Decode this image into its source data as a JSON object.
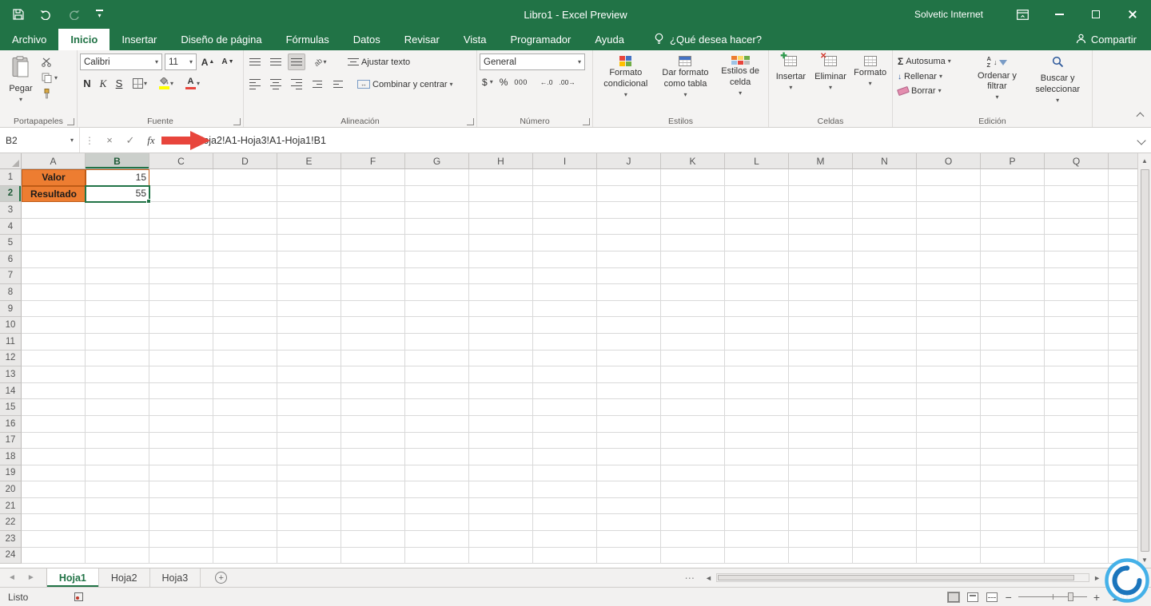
{
  "colors": {
    "excel_green": "#217346",
    "orange_fill": "#ED7D31",
    "orange_border": "#BF5B16",
    "arrow_red": "#E8453C"
  },
  "title_bar": {
    "title": "Libro1  -  Excel Preview",
    "account": "Solvetic Internet"
  },
  "tabs": {
    "items": [
      {
        "label": "Archivo",
        "active": false
      },
      {
        "label": "Inicio",
        "active": true
      },
      {
        "label": "Insertar",
        "active": false
      },
      {
        "label": "Diseño de página",
        "active": false
      },
      {
        "label": "Fórmulas",
        "active": false
      },
      {
        "label": "Datos",
        "active": false
      },
      {
        "label": "Revisar",
        "active": false
      },
      {
        "label": "Vista",
        "active": false
      },
      {
        "label": "Programador",
        "active": false
      },
      {
        "label": "Ayuda",
        "active": false
      }
    ],
    "search": "¿Qué desea hacer?",
    "share": "Compartir"
  },
  "ribbon": {
    "clipboard": {
      "paste": "Pegar",
      "group": "Portapapeles"
    },
    "font": {
      "family": "Calibri",
      "size": "11",
      "bold": "N",
      "italic": "K",
      "underline": "S",
      "group": "Fuente"
    },
    "alignment": {
      "wrap_text": "Ajustar texto",
      "merge_center": "Combinar y centrar",
      "group": "Alineación"
    },
    "number": {
      "format": "General",
      "currency": "$",
      "percent": "%",
      "thousands": "000",
      "group": "Número"
    },
    "styles": {
      "conditional": "Formato condicional",
      "format_table": "Dar formato como tabla",
      "cell_styles": "Estilos de celda",
      "group": "Estilos"
    },
    "cells": {
      "insert": "Insertar",
      "delete": "Eliminar",
      "format": "Formato",
      "group": "Celdas"
    },
    "editing": {
      "autosum": "Autosuma",
      "fill": "Rellenar",
      "clear": "Borrar",
      "sort_filter": "Ordenar y filtrar",
      "find_select": "Buscar y seleccionar",
      "group": "Edición"
    }
  },
  "formula_bar": {
    "name_box": "B2",
    "fx": "fx",
    "formula": "=Hoja2!A1-Hoja3!A1-Hoja1!B1"
  },
  "grid": {
    "columns": [
      "A",
      "B",
      "C",
      "D",
      "E",
      "F",
      "G",
      "H",
      "I",
      "J",
      "K",
      "L",
      "M",
      "N",
      "O",
      "P",
      "Q"
    ],
    "row_count": 24,
    "selected_cell": "B2",
    "selected_column": "B",
    "selected_row": 2,
    "cells": [
      {
        "ref": "A1",
        "text": "Valor",
        "classes": "orange"
      },
      {
        "ref": "B1",
        "text": "15",
        "classes": "num bordered"
      },
      {
        "ref": "A2",
        "text": "Resultado",
        "classes": "orange"
      },
      {
        "ref": "B2",
        "text": "55",
        "classes": "num"
      }
    ]
  },
  "sheets": {
    "items": [
      {
        "label": "Hoja1",
        "active": true
      },
      {
        "label": "Hoja2",
        "active": false
      },
      {
        "label": "Hoja3",
        "active": false
      }
    ]
  },
  "status_bar": {
    "mode": "Listo",
    "zoom": "100%"
  }
}
